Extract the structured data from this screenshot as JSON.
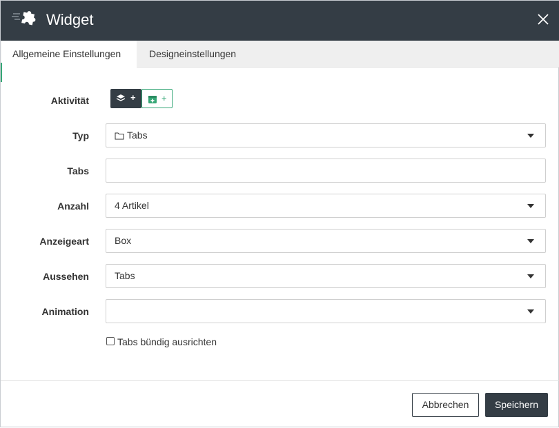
{
  "dialog": {
    "title": "Widget",
    "logo_icon": "puzzle-piece-icon",
    "close_icon": "close-icon"
  },
  "tabs": [
    {
      "label": "Allgemeine Einstellungen",
      "active": true
    },
    {
      "label": "Designeinstellungen",
      "active": false
    }
  ],
  "form": {
    "aktivitaet": {
      "label": "Aktivität",
      "buttons": [
        {
          "icon": "layers-icon",
          "text": "+"
        },
        {
          "icon": "calendar-add-icon",
          "text": "+"
        }
      ]
    },
    "typ": {
      "label": "Typ",
      "value": "Tabs",
      "icon": "folder-icon"
    },
    "tabs": {
      "label": "Tabs",
      "value": ""
    },
    "anzahl": {
      "label": "Anzahl",
      "value": "4 Artikel"
    },
    "anzeigeart": {
      "label": "Anzeigeart",
      "value": "Box"
    },
    "aussehen": {
      "label": "Aussehen",
      "value": "Tabs"
    },
    "animation": {
      "label": "Animation",
      "value": ""
    },
    "buendig": {
      "label": "Tabs bündig ausrichten",
      "checked": false
    }
  },
  "footer": {
    "cancel_label": "Abbrechen",
    "save_label": "Speichern"
  },
  "colors": {
    "header_bg": "#343d45",
    "accent_green": "#35a776",
    "tab_bar_bg": "#efefef"
  }
}
